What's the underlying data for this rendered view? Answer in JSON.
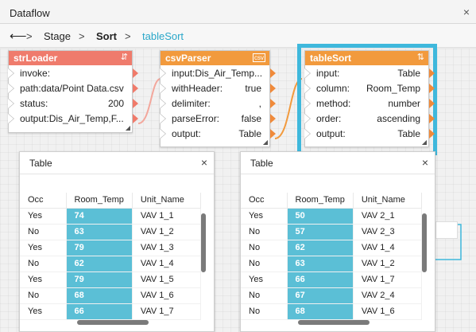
{
  "window": {
    "title": "Dataflow",
    "close": "×"
  },
  "breadcrumb": {
    "back": "⟵",
    "sep": ">",
    "items": [
      "Stage",
      "Sort",
      "tableSort"
    ]
  },
  "colors": {
    "strLoader": "#ef7b6c",
    "csvParser": "#f29a3d",
    "tableSort": "#f29a3d",
    "selection": "#3fb8dc",
    "highlight": "#5bbfd6"
  },
  "nodes": {
    "strLoader": {
      "title": "strLoader",
      "icon": "⇵",
      "rows": [
        {
          "k": "invoke:",
          "v": ""
        },
        {
          "k": "path:",
          "v": "data/Point Data.csv"
        },
        {
          "k": "status:",
          "v": "200"
        },
        {
          "k": "output:",
          "v": "Dis_Air_Temp,F..."
        }
      ]
    },
    "csvParser": {
      "title": "csvParser",
      "icon": "csv",
      "rows": [
        {
          "k": "input:",
          "v": "Dis_Air_Temp..."
        },
        {
          "k": "withHeader:",
          "v": "true"
        },
        {
          "k": "delimiter:",
          "v": ","
        },
        {
          "k": "parseError:",
          "v": "false"
        },
        {
          "k": "output:",
          "v": "Table"
        }
      ]
    },
    "tableSort": {
      "title": "tableSort",
      "icon": "⇅",
      "rows": [
        {
          "k": "input:",
          "v": "Table"
        },
        {
          "k": "column:",
          "v": "Room_Temp"
        },
        {
          "k": "method:",
          "v": "number"
        },
        {
          "k": "order:",
          "v": "ascending"
        },
        {
          "k": "output:",
          "v": "Table"
        }
      ]
    }
  },
  "tables": {
    "left": {
      "title": "Table",
      "headers": [
        "Occ",
        "Room_Temp",
        "Unit_Name"
      ],
      "rows": [
        [
          "Yes",
          "74",
          "VAV 1_1"
        ],
        [
          "No",
          "63",
          "VAV 1_2"
        ],
        [
          "Yes",
          "79",
          "VAV 1_3"
        ],
        [
          "No",
          "62",
          "VAV 1_4"
        ],
        [
          "Yes",
          "79",
          "VAV 1_5"
        ],
        [
          "No",
          "68",
          "VAV 1_6"
        ],
        [
          "Yes",
          "66",
          "VAV 1_7"
        ]
      ]
    },
    "right": {
      "title": "Table",
      "headers": [
        "Occ",
        "Room_Temp",
        "Unit_Name"
      ],
      "rows": [
        [
          "Yes",
          "50",
          "VAV 2_1"
        ],
        [
          "No",
          "57",
          "VAV 2_3"
        ],
        [
          "No",
          "62",
          "VAV 1_4"
        ],
        [
          "No",
          "63",
          "VAV 1_2"
        ],
        [
          "Yes",
          "66",
          "VAV 1_7"
        ],
        [
          "No",
          "67",
          "VAV 2_4"
        ],
        [
          "No",
          "68",
          "VAV 1_6"
        ]
      ]
    }
  }
}
